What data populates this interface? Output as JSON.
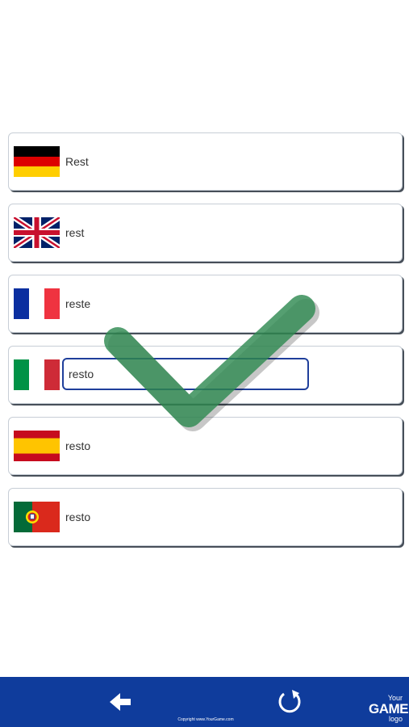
{
  "rows": [
    {
      "language": "German",
      "flag_icon": "germany-flag-icon",
      "word": "Rest"
    },
    {
      "language": "English",
      "flag_icon": "uk-flag-icon",
      "word": "rest"
    },
    {
      "language": "French",
      "flag_icon": "france-flag-icon",
      "word": "reste"
    },
    {
      "language": "Italian",
      "flag_icon": "italy-flag-icon",
      "input_value": "resto"
    },
    {
      "language": "Spanish",
      "flag_icon": "spain-flag-icon",
      "word": "resto"
    },
    {
      "language": "Portuguese",
      "flag_icon": "portugal-flag-icon",
      "word": "resto"
    }
  ],
  "overlay": {
    "icon": "checkmark-icon",
    "color": "#2f8a52"
  },
  "bottom_bar": {
    "background": "#0f3c9c",
    "back_icon": "back-arrow-icon",
    "refresh_icon": "refresh-icon",
    "copyright": "Copyright www.YourGame.com",
    "logo": {
      "top": "Your",
      "main": "GAME",
      "bottom": "logo"
    }
  }
}
